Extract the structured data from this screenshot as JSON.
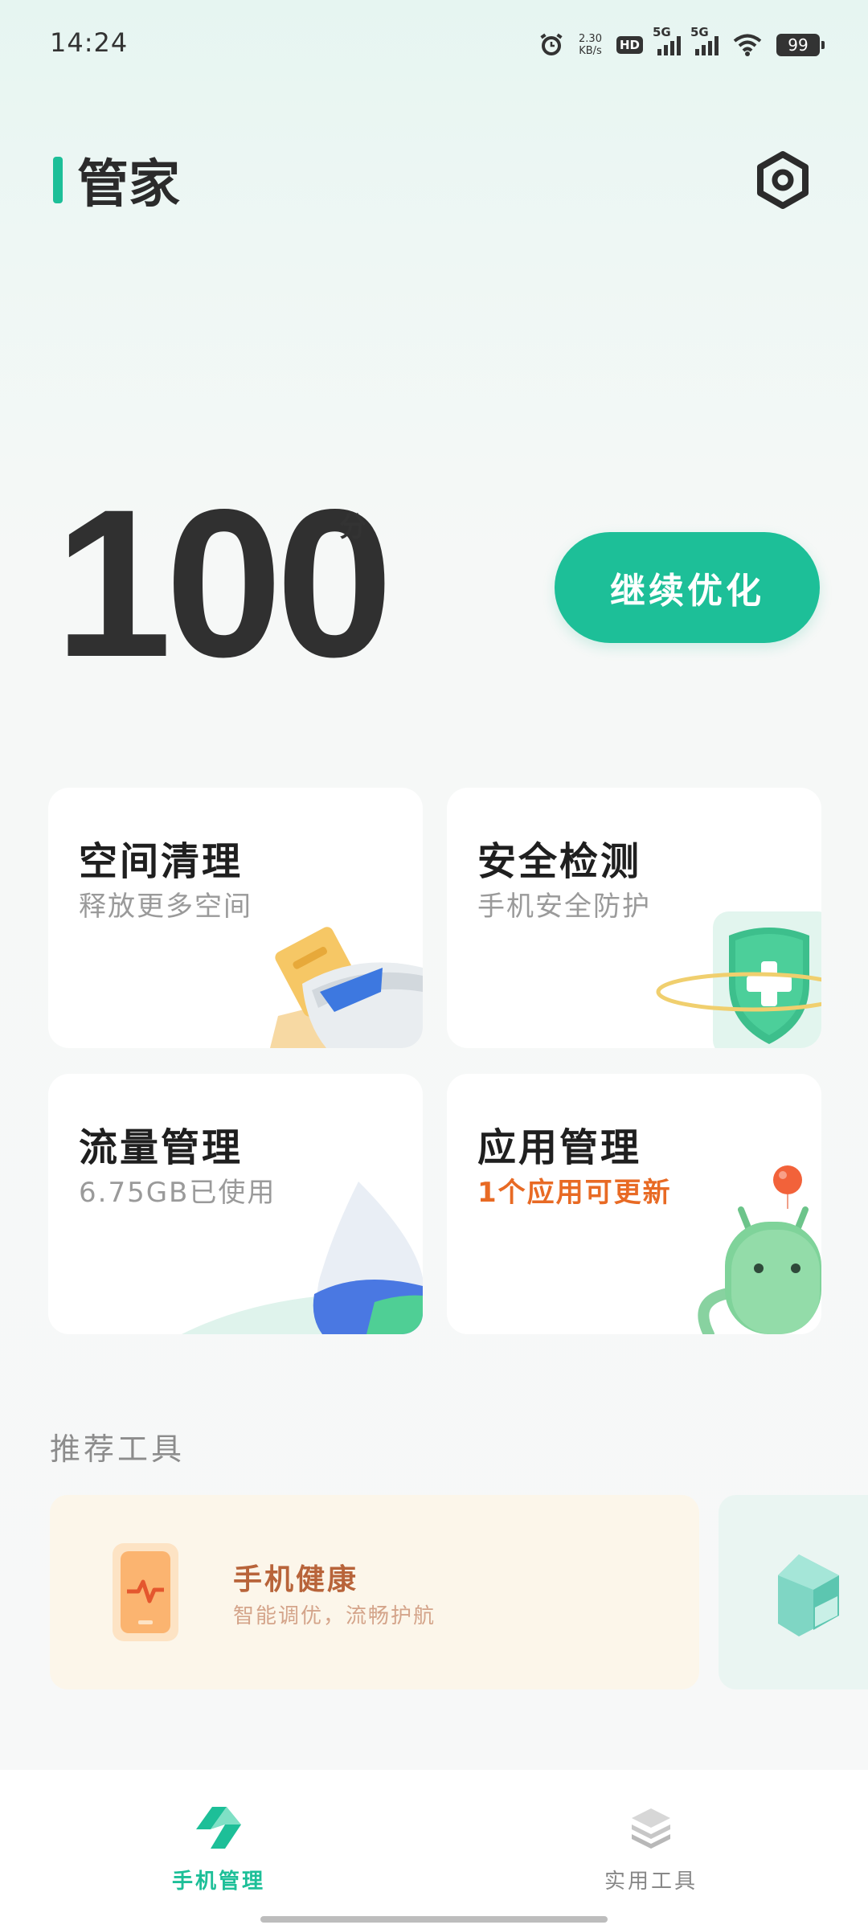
{
  "status_bar": {
    "time": "14:24",
    "net_speed_value": "2.30",
    "net_speed_unit": "KB/s",
    "hd_label": "HD",
    "sim1": "5G",
    "sim2": "5G",
    "battery": "99"
  },
  "header": {
    "title": "管家",
    "settings_icon": "settings-hexagon-icon"
  },
  "score": {
    "value": "100",
    "unit": "分",
    "action_label": "继续优化"
  },
  "cards": [
    {
      "title": "空间清理",
      "subtitle": "释放更多空间",
      "icon": "cleaner-bucket-icon"
    },
    {
      "title": "安全检测",
      "subtitle": "手机安全防护",
      "icon": "shield-plus-icon"
    },
    {
      "title": "流量管理",
      "subtitle": "6.75GB已使用",
      "icon": "water-drop-icon"
    },
    {
      "title": "应用管理",
      "subtitle": "1个应用可更新",
      "icon": "android-robot-icon"
    }
  ],
  "recommended": {
    "section_title": "推荐工具",
    "tools": [
      {
        "name": "手机健康",
        "description": "智能调优，流畅护航",
        "icon": "phone-pulse-icon"
      },
      {
        "name": "",
        "description": "",
        "icon": "cube-icon"
      }
    ]
  },
  "bottom_nav": {
    "items": [
      {
        "label": "手机管理",
        "active": true,
        "icon": "phone-manager-icon"
      },
      {
        "label": "实用工具",
        "active": false,
        "icon": "layers-icon"
      }
    ]
  },
  "colors": {
    "accent": "#1dbf98",
    "warning": "#e86a24"
  }
}
